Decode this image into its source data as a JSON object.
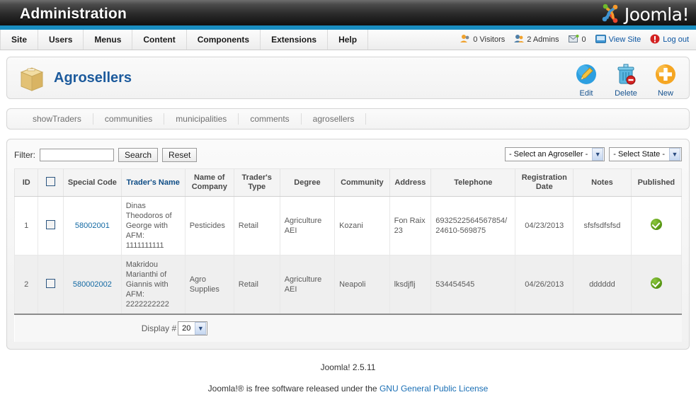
{
  "header": {
    "title": "Administration",
    "logo_text": "Joomla!",
    "logo_icon": "joomla-logo-icon"
  },
  "mainmenu": [
    {
      "label": "Site"
    },
    {
      "label": "Users"
    },
    {
      "label": "Menus"
    },
    {
      "label": "Content"
    },
    {
      "label": "Components"
    },
    {
      "label": "Extensions"
    },
    {
      "label": "Help"
    }
  ],
  "status": [
    {
      "icon": "visitors-icon",
      "label": "0 Visitors"
    },
    {
      "icon": "admins-icon",
      "label": "2 Admins"
    },
    {
      "icon": "messages-icon",
      "label": "0"
    },
    {
      "icon": "view-site-icon",
      "label": "View Site"
    },
    {
      "icon": "logout-icon",
      "label": "Log out"
    }
  ],
  "page": {
    "title": "Agrosellers",
    "icon": "box-icon"
  },
  "toolbar": [
    {
      "label": "Edit",
      "icon": "edit-pencil-icon"
    },
    {
      "label": "Delete",
      "icon": "trash-icon"
    },
    {
      "label": "New",
      "icon": "plus-icon"
    }
  ],
  "submenu": [
    {
      "label": "showTraders"
    },
    {
      "label": "communities"
    },
    {
      "label": "municipalities"
    },
    {
      "label": "comments"
    },
    {
      "label": "agrosellers"
    }
  ],
  "filter": {
    "label": "Filter:",
    "value": "",
    "placeholder": "",
    "search_label": "Search",
    "reset_label": "Reset"
  },
  "selects": {
    "agroseller": "- Select an Agroseller -",
    "state": "- Select State -"
  },
  "table": {
    "columns": [
      "ID",
      "",
      "Special Code",
      "Trader's Name",
      "Name of Company",
      "Trader's Type",
      "Degree",
      "Community",
      "Address",
      "Telephone",
      "Registration Date",
      "Notes",
      "Published"
    ],
    "sorted_column": "Trader's Name",
    "rows": [
      {
        "id": "1",
        "special_code": "58002001",
        "traders_name": "Dinas Theodoros of George with AFM: 1111111111",
        "name_of_company": "Pesticides",
        "traders_type": "Retail",
        "degree": "Agriculture AEI",
        "community": "Kozani",
        "address": "Fon Raix 23",
        "telephone": "6932522564567854/ 24610-569875",
        "registration_date": "04/23/2013",
        "notes": "sfsfsdfsfsd",
        "published": true
      },
      {
        "id": "2",
        "special_code": "580002002",
        "traders_name": "Makridou Marianthi of Giannis with AFM: 2222222222",
        "name_of_company": "Agro Supplies",
        "traders_type": "Retail",
        "degree": "Agriculture AEI",
        "community": "Neapoli",
        "address": "lksdjflj",
        "telephone": "534454545",
        "registration_date": "04/26/2013",
        "notes": "dddddd",
        "published": true
      }
    ],
    "footer": {
      "display_label": "Display #",
      "display_value": "20"
    }
  },
  "footer": {
    "version": "Joomla! 2.5.11",
    "license_prefix": "Joomla!® is free software released under the ",
    "license_link": "GNU General Public License"
  },
  "colors": {
    "accent_blue": "#1a8ec1",
    "title_blue": "#1c5a9c",
    "link_blue": "#1369a3",
    "published_green": "#5d9c16"
  }
}
